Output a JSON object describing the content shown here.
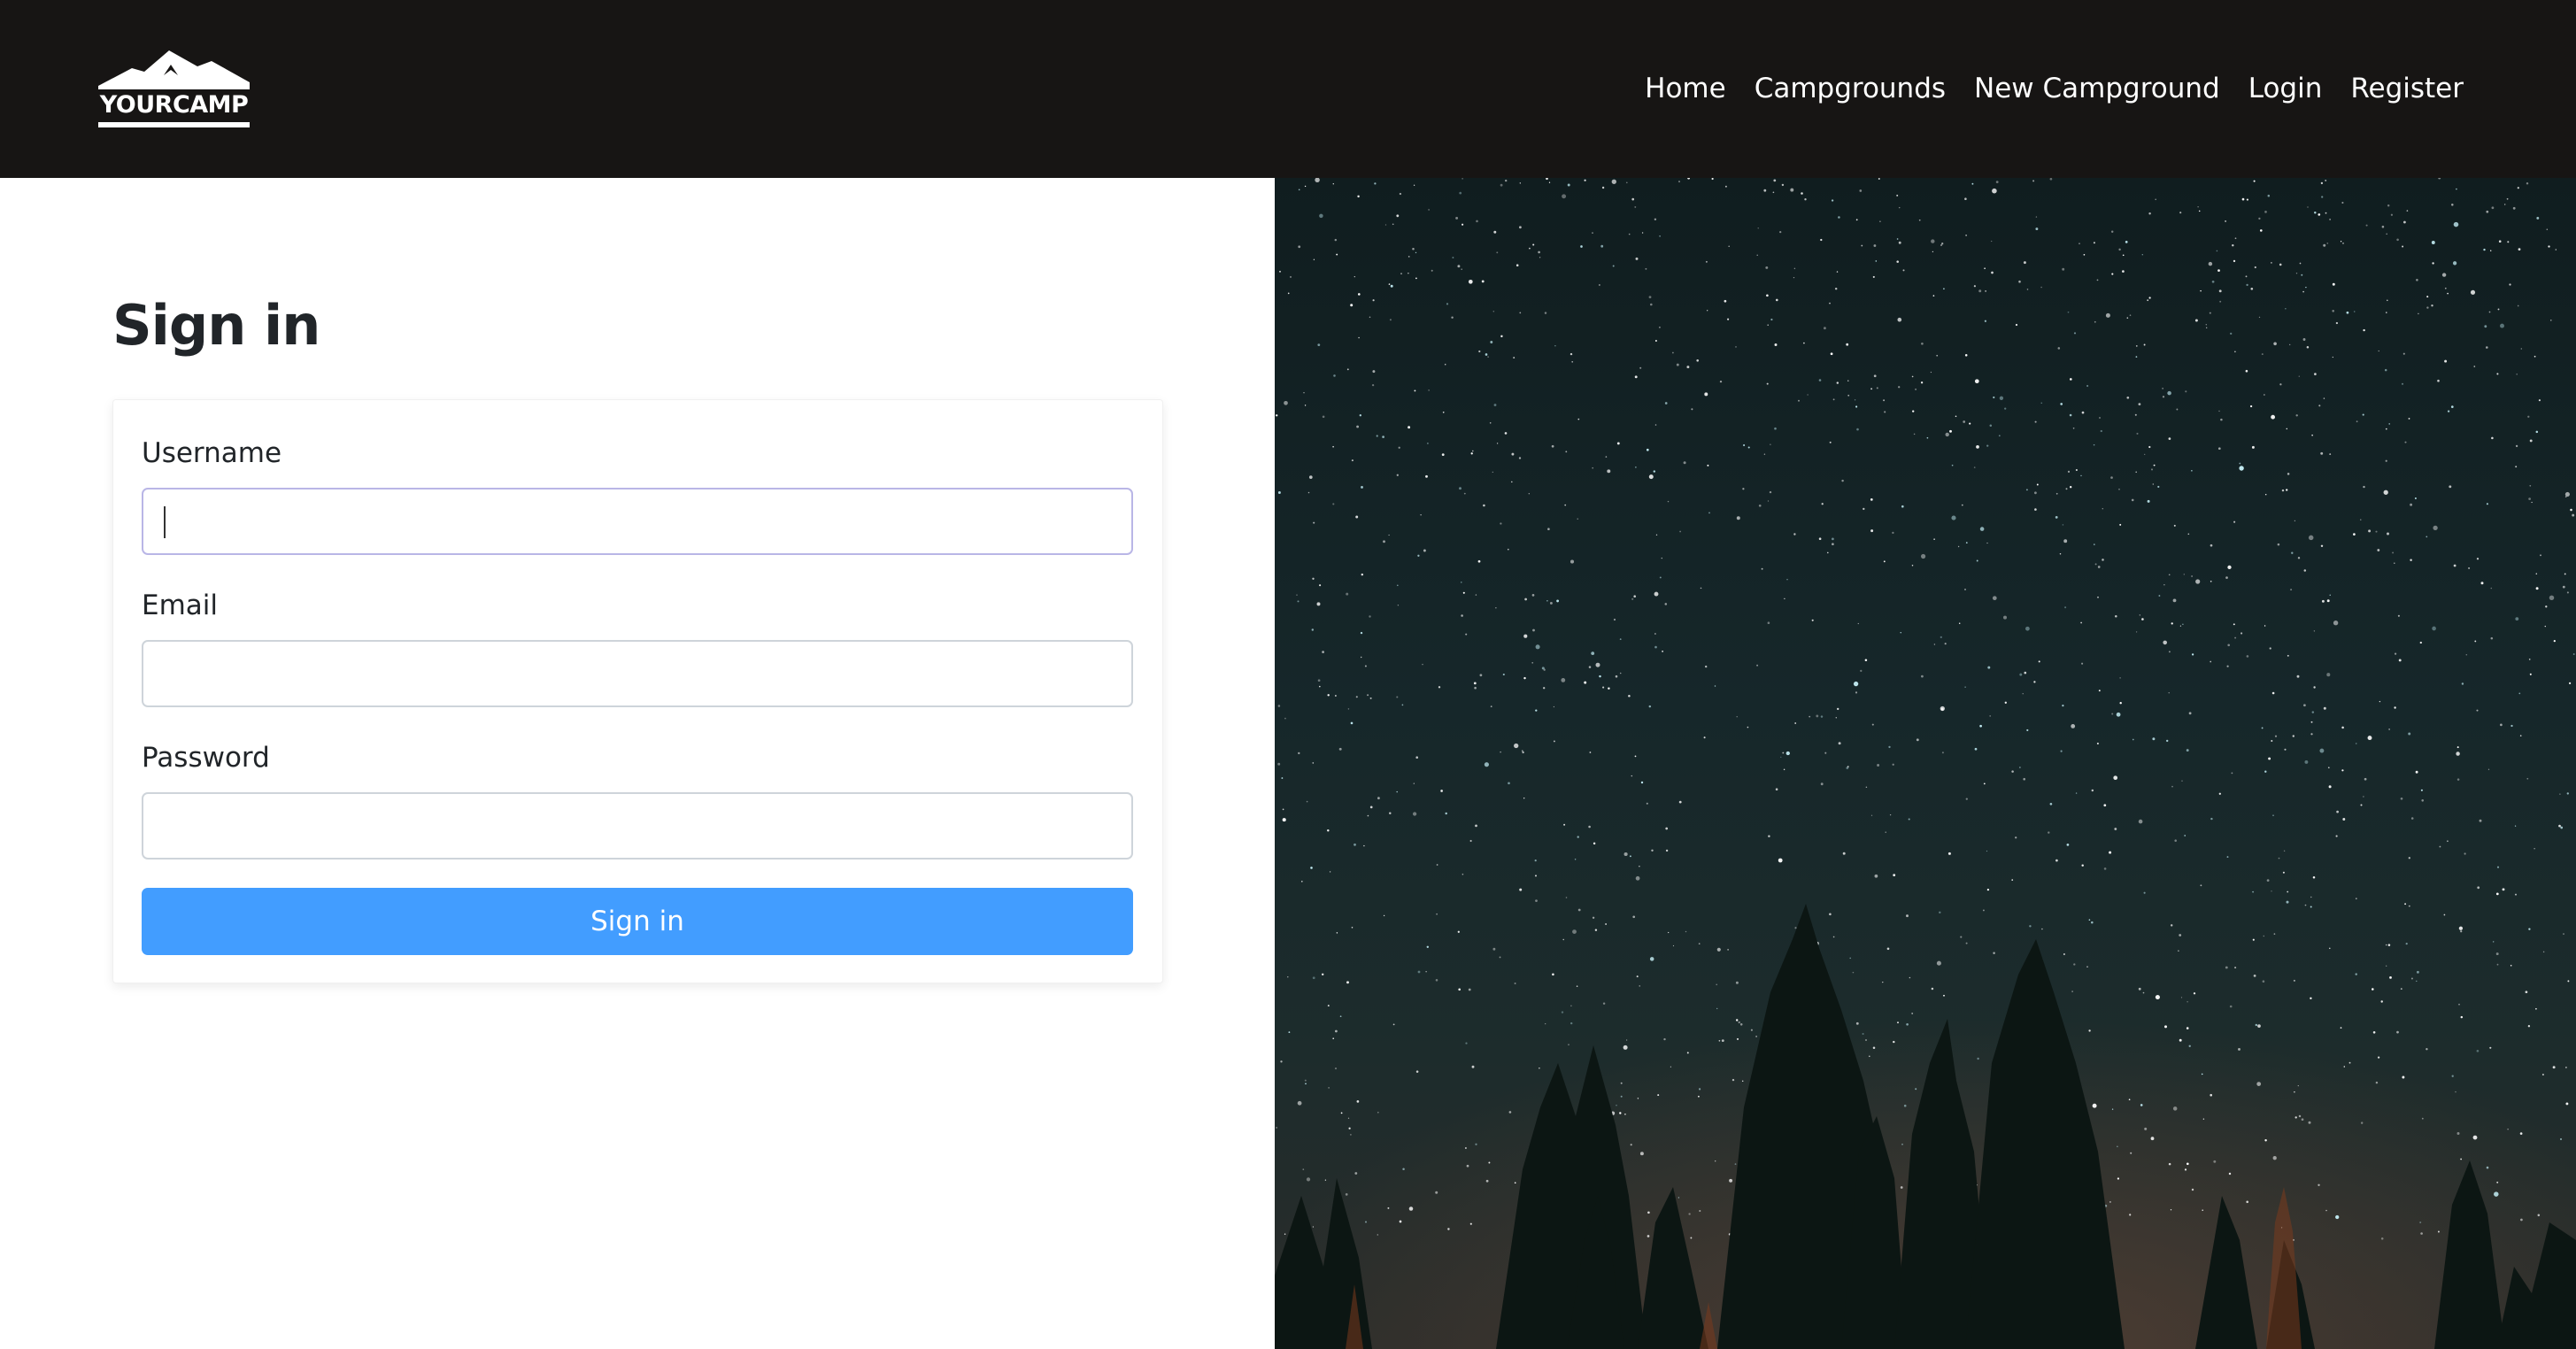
{
  "brand": {
    "name": "YOURCAMP"
  },
  "nav": {
    "links": [
      {
        "label": "Home"
      },
      {
        "label": "Campgrounds"
      },
      {
        "label": "New Campground"
      },
      {
        "label": "Login"
      },
      {
        "label": "Register"
      }
    ]
  },
  "page": {
    "title": "Sign in"
  },
  "form": {
    "username": {
      "label": "Username",
      "value": "",
      "placeholder": ""
    },
    "email": {
      "label": "Email",
      "value": "",
      "placeholder": ""
    },
    "password": {
      "label": "Password",
      "value": "",
      "placeholder": ""
    },
    "submit_label": "Sign in"
  },
  "colors": {
    "navbar": "#171514",
    "primary_button": "#429dff",
    "focus_border": "#b9b6e6"
  },
  "icons": {
    "logo": "mountain-logo-icon"
  }
}
